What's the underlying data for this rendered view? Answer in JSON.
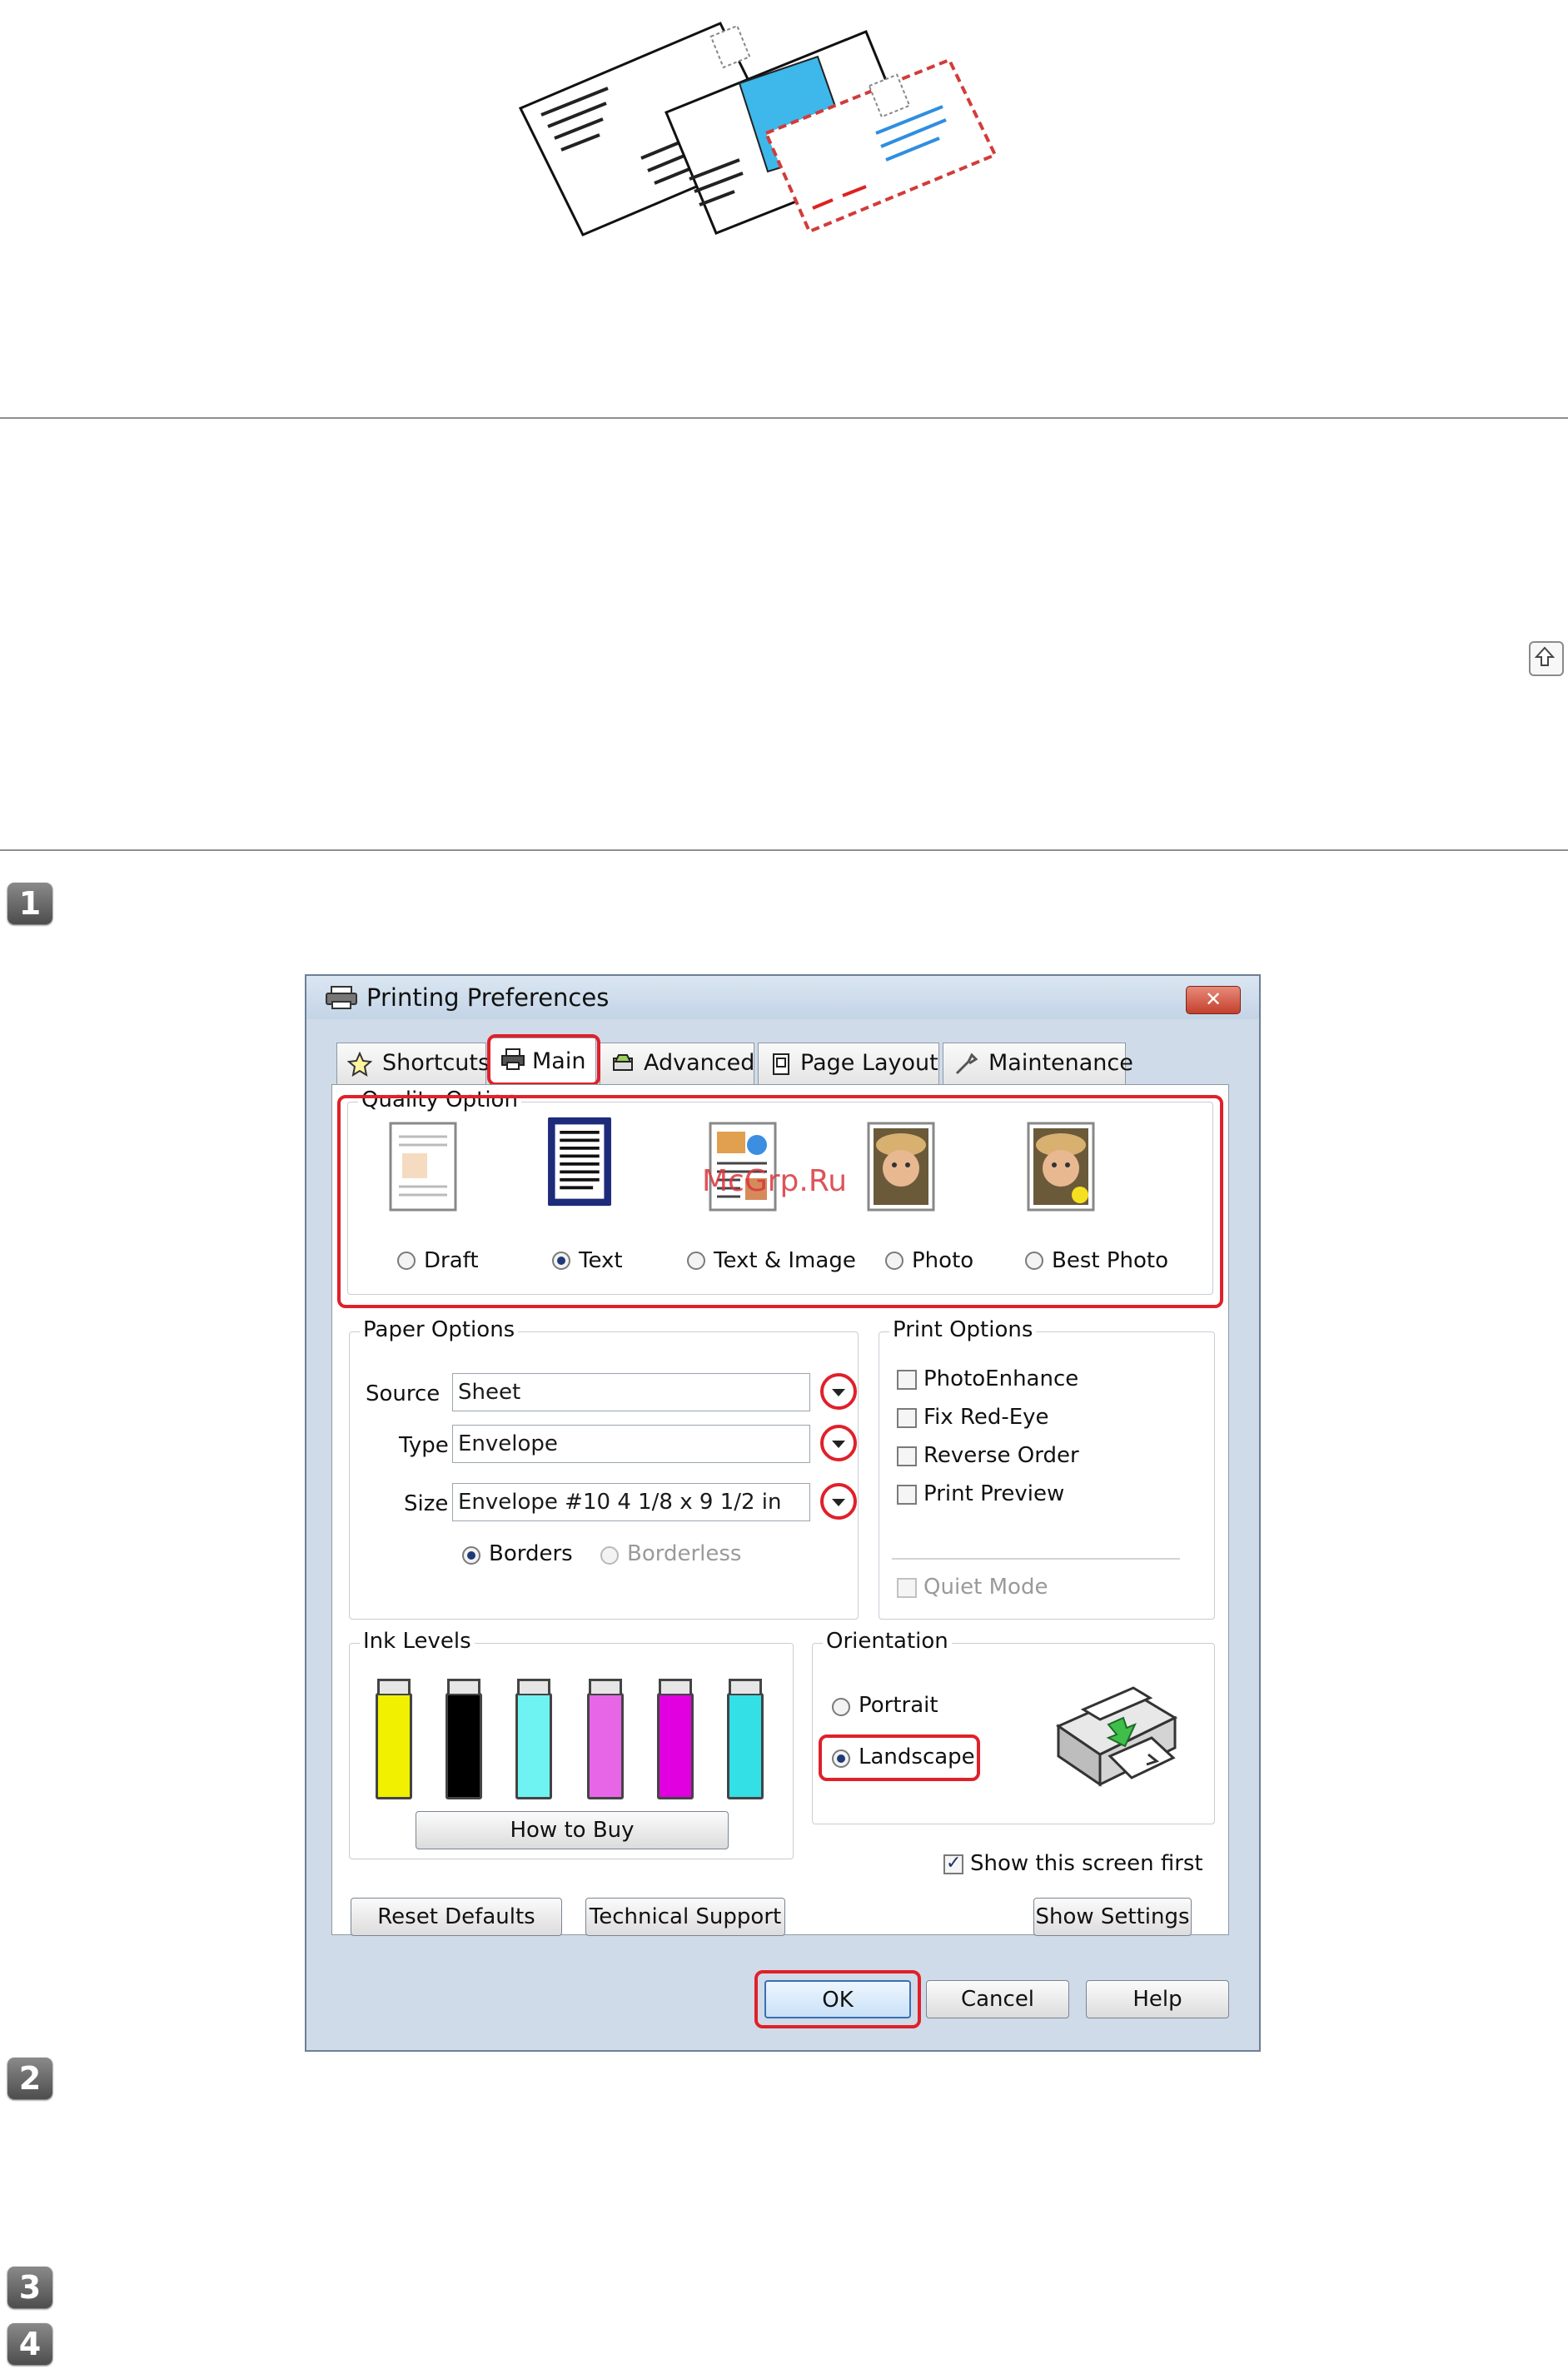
{
  "steps": [
    "1",
    "2",
    "3",
    "4"
  ],
  "watermark": "McGrp.Ru",
  "dialog": {
    "title": "Printing Preferences",
    "close_label": "✕",
    "tabs": [
      {
        "label": "Shortcuts",
        "icon": "star-icon"
      },
      {
        "label": "Main",
        "icon": "printer-icon",
        "active": true
      },
      {
        "label": "Advanced",
        "icon": "advanced-icon"
      },
      {
        "label": "Page Layout",
        "icon": "page-layout-icon"
      },
      {
        "label": "Maintenance",
        "icon": "wrench-icon"
      }
    ],
    "quality_option": {
      "label": "Quality Option",
      "options": [
        "Draft",
        "Text",
        "Text & Image",
        "Photo",
        "Best Photo"
      ],
      "selected": "Text"
    },
    "paper_options": {
      "label": "Paper Options",
      "source_label": "Source",
      "source_value": "Sheet",
      "type_label": "Type",
      "type_value": "Envelope",
      "size_label": "Size",
      "size_value": "Envelope #10 4 1/8 x 9 1/2 in",
      "borders_label": "Borders",
      "borderless_label": "Borderless"
    },
    "print_options": {
      "label": "Print Options",
      "photo_enhance": "PhotoEnhance",
      "fix_red_eye": "Fix Red-Eye",
      "reverse_order": "Reverse Order",
      "print_preview": "Print Preview",
      "quiet_mode": "Quiet Mode"
    },
    "ink_levels": {
      "label": "Ink Levels",
      "colors": [
        "#f0f000",
        "#000000",
        "#6ff2f2",
        "#e766e7",
        "#e000e0",
        "#33e0e6"
      ],
      "how_to_buy": "How to Buy"
    },
    "orientation": {
      "label": "Orientation",
      "portrait": "Portrait",
      "landscape": "Landscape",
      "selected": "Landscape"
    },
    "show_first": "Show this screen first",
    "buttons": {
      "reset_defaults": "Reset Defaults",
      "technical_support": "Technical Support",
      "show_settings": "Show Settings",
      "ok": "OK",
      "cancel": "Cancel",
      "help": "Help"
    }
  }
}
